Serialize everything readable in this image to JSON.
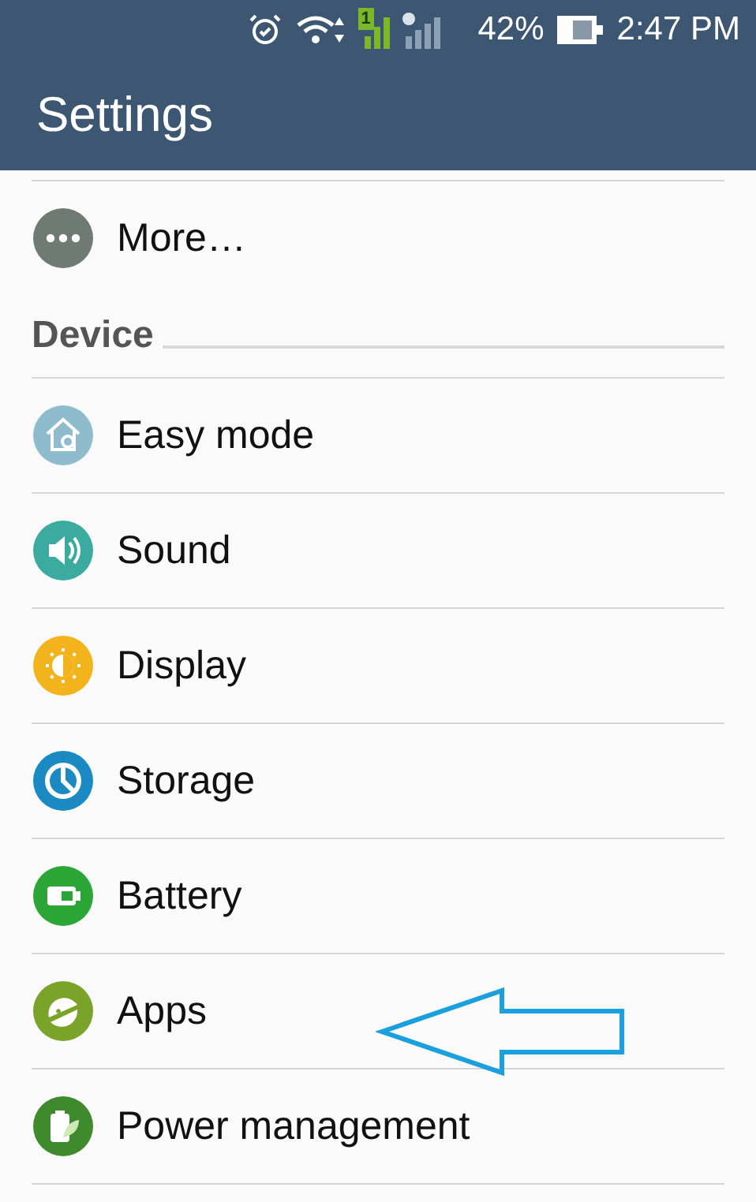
{
  "status_bar": {
    "sim_badge": "1",
    "battery": "42%",
    "time": "2:47 PM"
  },
  "app_bar": {
    "title": "Settings"
  },
  "sections": [
    {
      "items": [
        {
          "label": "More…",
          "color": "#6e7a72"
        }
      ]
    },
    {
      "title": "Device",
      "items": [
        {
          "label": "Easy mode",
          "color": "#8fbccc"
        },
        {
          "label": "Sound",
          "color": "#3aab9e"
        },
        {
          "label": "Display",
          "color": "#f2b31c"
        },
        {
          "label": "Storage",
          "color": "#1b8ac2"
        },
        {
          "label": "Battery",
          "color": "#2aa536"
        },
        {
          "label": "Apps",
          "color": "#7aa32a"
        },
        {
          "label": "Power management",
          "color": "#3e8a2c"
        }
      ]
    }
  ]
}
